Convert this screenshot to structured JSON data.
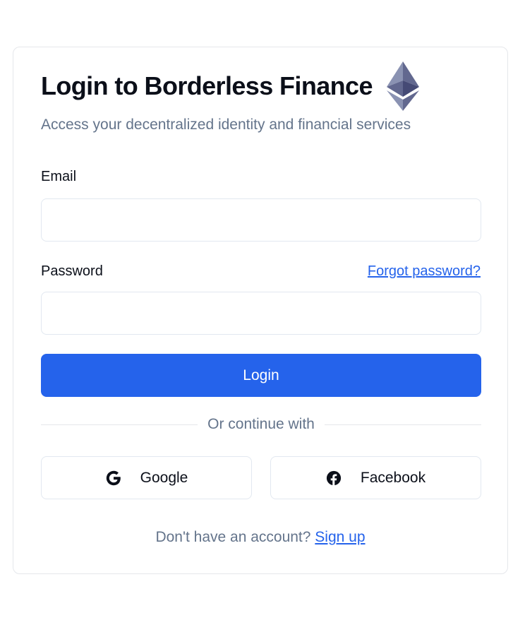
{
  "header": {
    "title": "Login to Borderless Finance",
    "logo_icon": "ethereum-logo-icon",
    "subtitle": "Access your decentralized identity and financial services"
  },
  "form": {
    "email_label": "Email",
    "email_value": "",
    "password_label": "Password",
    "password_value": "",
    "forgot_label": "Forgot password?",
    "login_label": "Login"
  },
  "divider": {
    "text": "Or continue with"
  },
  "social": {
    "google": {
      "label": "Google",
      "icon": "google-icon"
    },
    "facebook": {
      "label": "Facebook",
      "icon": "facebook-icon"
    }
  },
  "footer": {
    "prompt": "Don't have an account?",
    "signup_label": "Sign up"
  },
  "colors": {
    "accent": "#2563eb",
    "muted_text": "#64748b",
    "border": "#e2e8f0"
  }
}
